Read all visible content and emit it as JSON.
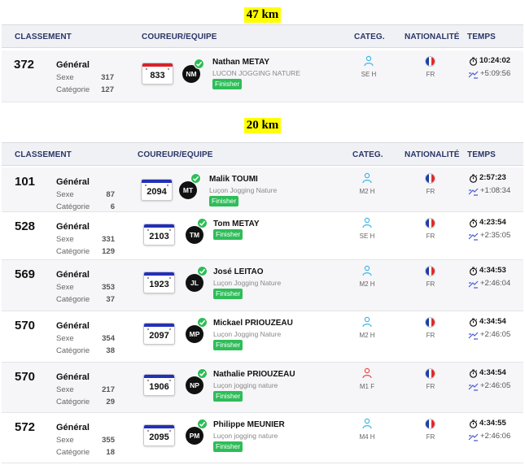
{
  "sections": [
    {
      "title": "47 km",
      "headers": {
        "classement": "CLASSEMENT",
        "coureur": "COUREUR/EQUIPE",
        "categ": "CATEG.",
        "nationalite": "NATIONALITÉ",
        "temps": "TEMPS"
      },
      "labels": {
        "general": "Général",
        "sexe": "Sexe",
        "categorie": "Catégorie",
        "finisher": "Finisher"
      },
      "rows": [
        {
          "rank": "372",
          "sexe": "317",
          "categorie": "127",
          "bib": "833",
          "bib_color": "#d8222a",
          "initials": "NM",
          "name": "Nathan METAY",
          "team": "LUCON JOGGING NATURE",
          "cat": "SE H",
          "gender": "male",
          "nat": "FR",
          "time": "10:24:02",
          "gap": "+5:09:56"
        }
      ]
    },
    {
      "title": "20 km",
      "headers": {
        "classement": "CLASSEMENT",
        "coureur": "COUREUR/EQUIPE",
        "categ": "CATEG.",
        "nationalite": "NATIONALITÉ",
        "temps": "TEMPS"
      },
      "labels": {
        "general": "Général",
        "sexe": "Sexe",
        "categorie": "Catégorie",
        "finisher": "Finisher"
      },
      "rows": [
        {
          "rank": "101",
          "sexe": "87",
          "categorie": "6",
          "bib": "2094",
          "bib_color": "#2430b8",
          "initials": "MT",
          "name": "Malik TOUMI",
          "team": "Luçon Jogging Nature",
          "cat": "M2 H",
          "gender": "male",
          "nat": "FR",
          "time": "2:57:23",
          "gap": "+1:08:34"
        },
        {
          "rank": "528",
          "sexe": "331",
          "categorie": "129",
          "bib": "2103",
          "bib_color": "#2430b8",
          "initials": "TM",
          "name": "Tom METAY",
          "team": "",
          "cat": "SE H",
          "gender": "male",
          "nat": "FR",
          "time": "4:23:54",
          "gap": "+2:35:05"
        },
        {
          "rank": "569",
          "sexe": "353",
          "categorie": "37",
          "bib": "1923",
          "bib_color": "#2430b8",
          "initials": "JL",
          "name": "José LEITAO",
          "team": "Luçon Jogging Nature",
          "cat": "M2 H",
          "gender": "male",
          "nat": "FR",
          "time": "4:34:53",
          "gap": "+2:46:04"
        },
        {
          "rank": "570",
          "sexe": "354",
          "categorie": "38",
          "bib": "2097",
          "bib_color": "#2430b8",
          "initials": "MP",
          "name": "Mickael PRIOUZEAU",
          "team": "Luçon Jogging Nature",
          "cat": "M2 H",
          "gender": "male",
          "nat": "FR",
          "time": "4:34:54",
          "gap": "+2:46:05"
        },
        {
          "rank": "570",
          "sexe": "217",
          "categorie": "29",
          "bib": "1906",
          "bib_color": "#2430b8",
          "initials": "NP",
          "name": "Nathalie PRIOUZEAU",
          "team": "Luçon jogging nature",
          "cat": "M1 F",
          "gender": "female",
          "nat": "FR",
          "time": "4:34:54",
          "gap": "+2:46:05"
        },
        {
          "rank": "572",
          "sexe": "355",
          "categorie": "18",
          "bib": "2095",
          "bib_color": "#2430b8",
          "initials": "PM",
          "name": "Philippe MEUNIER",
          "team": "Luçon jogging nature",
          "cat": "M4 H",
          "gender": "male",
          "nat": "FR",
          "time": "4:34:55",
          "gap": "+2:46:06"
        }
      ]
    }
  ],
  "colors": {
    "male": "#3db6e8",
    "female": "#e84a4a",
    "finisher": "#2ebd59",
    "flag_blue": "#1d3fa8",
    "flag_white": "#ffffff",
    "flag_red": "#e12a2a"
  }
}
